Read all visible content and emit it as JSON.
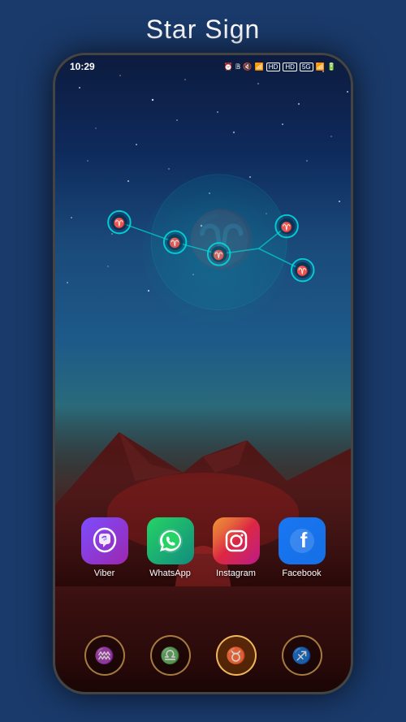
{
  "page": {
    "title": "Star Sign",
    "background_color": "#1a3a6b"
  },
  "status_bar": {
    "time": "10:29",
    "icons": [
      "alarm",
      "bluetooth",
      "mute",
      "wifi",
      "hd",
      "hd",
      "5g",
      "signal",
      "battery"
    ]
  },
  "apps": [
    {
      "id": "viber",
      "label": "Viber",
      "icon_type": "viber",
      "symbol": "☎"
    },
    {
      "id": "whatsapp",
      "label": "WhatsApp",
      "icon_type": "whatsapp",
      "symbol": "✆"
    },
    {
      "id": "instagram",
      "label": "Instagram",
      "icon_type": "instagram",
      "symbol": "◎"
    },
    {
      "id": "facebook",
      "label": "Facebook",
      "icon_type": "facebook",
      "symbol": "f"
    }
  ],
  "dock": [
    {
      "id": "aquarius",
      "symbol": "♒"
    },
    {
      "id": "libra",
      "symbol": "♎"
    },
    {
      "id": "taurus",
      "symbol": "♉"
    },
    {
      "id": "sagittarius",
      "symbol": "♐"
    }
  ],
  "constellation": {
    "sign": "Aries",
    "symbol": "♈"
  }
}
